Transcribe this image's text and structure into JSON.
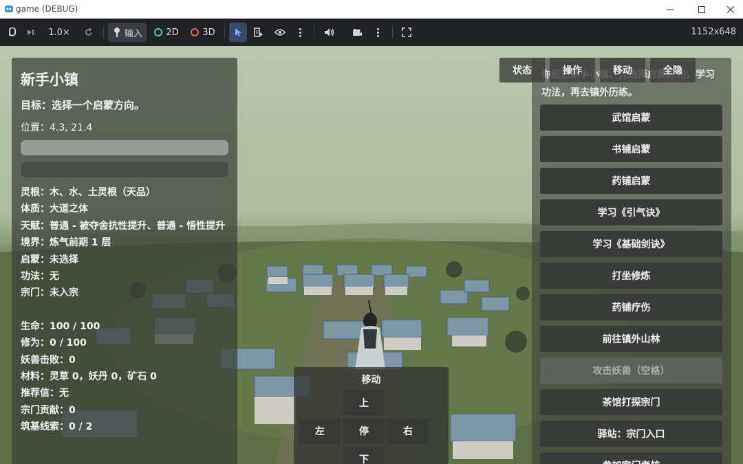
{
  "window": {
    "title": "game (DEBUG)",
    "resolution": "1152x648"
  },
  "toolbar": {
    "speed": "1.0×",
    "input_label": "输入",
    "mode_2d": "2D",
    "mode_3d": "3D",
    "colors": {
      "ring_2d": "#5fc8a0",
      "ring_3d": "#e0605a"
    }
  },
  "left_panel": {
    "title": "新手小镇",
    "goal": "目标：选择一个启蒙方向。",
    "position": "位置：4.3, 21.4",
    "stats": [
      "灵根：木、水、土灵根（天品）",
      "体质：大道之体",
      "天赋：普通 - 被夺舍抗性提升、普通 - 悟性提升",
      "境界：炼气前期 1 层",
      "启蒙：未选择",
      "功法：无",
      "宗门：未入宗"
    ],
    "stats2": [
      "生命：100 / 100",
      "修为：0 / 100",
      "妖兽击败：0",
      "材料：灵草 0，妖丹 0，矿石 0",
      "推荐信：无",
      "宗门贡献：0",
      "筑基线索：0 / 2"
    ]
  },
  "tabs": [
    "状态",
    "操作",
    "移动",
    "全隐"
  ],
  "right_panel": {
    "intro": "你抵达新手小镇。先选择启蒙方向，学习功法，再去镇外历练。",
    "buttons": [
      "武馆启蒙",
      "书铺启蒙",
      "药铺启蒙",
      "学习《引气诀》",
      "学习《基础剑诀》",
      "打坐修炼",
      "药铺疗伤",
      "前往镇外山林",
      "攻击妖兽（空格）",
      "茶馆打探宗门",
      "驿站：宗门入口",
      "参加宗门考核"
    ]
  },
  "movepad": {
    "title": "移动",
    "up": "上",
    "left": "左",
    "stop": "停",
    "right": "右",
    "down": "下"
  }
}
